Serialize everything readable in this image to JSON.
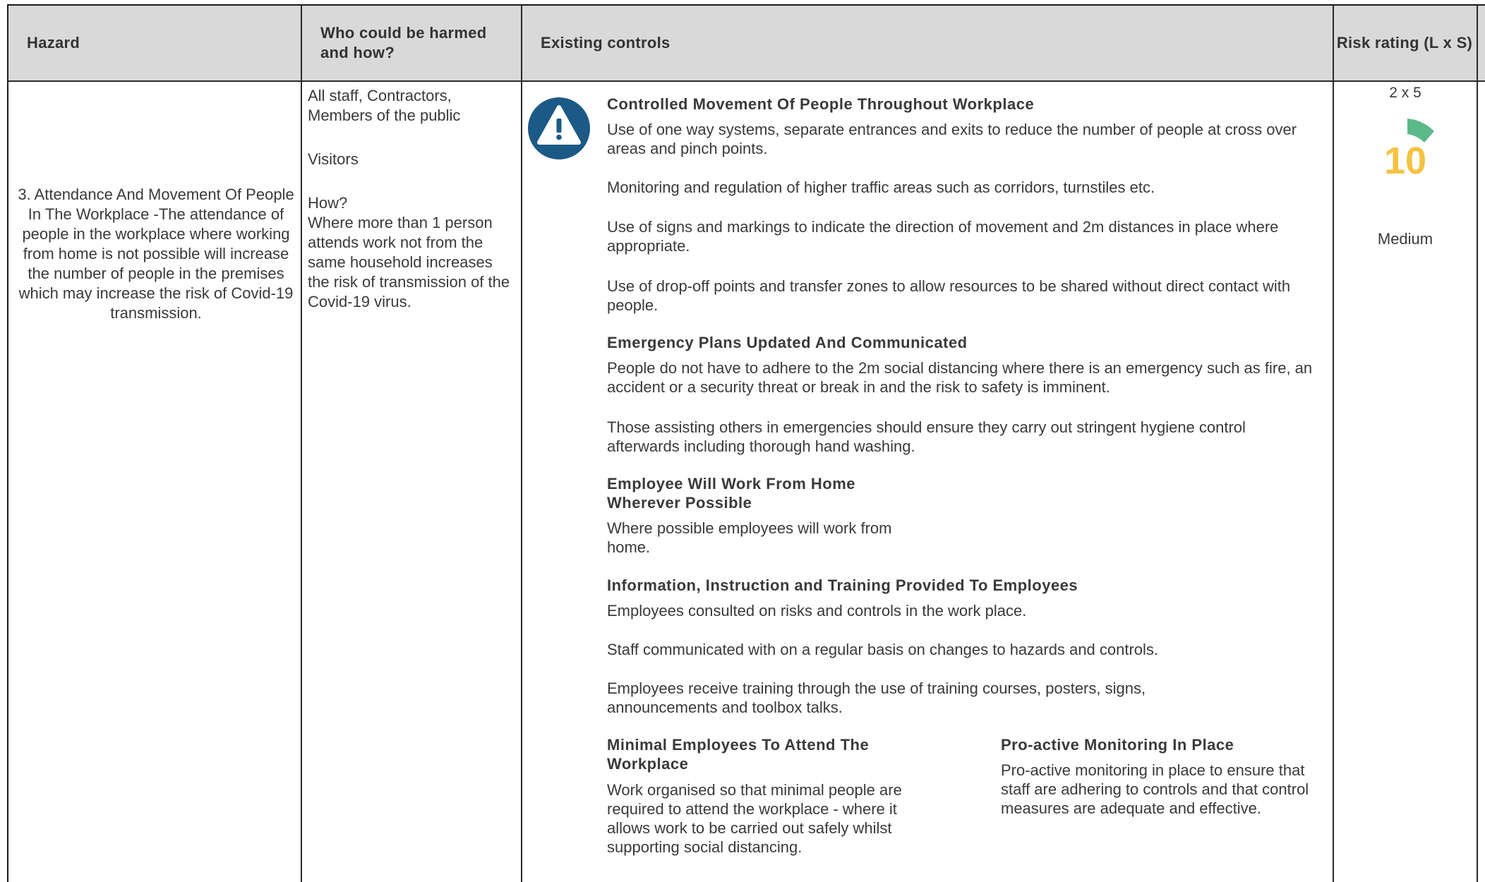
{
  "header": {
    "hazard": "Hazard",
    "who": "Who could be harmed and how?",
    "controls": "Existing controls",
    "risk": "Risk rating (L x S)"
  },
  "hazard": {
    "text": "3. Attendance And Movement Of People In The Workplace -The attendance of people in the workplace where working from home is not possible will increase the number of people in the premises which may increase the risk of Covid-19 transmission."
  },
  "who": {
    "groups": "All staff, Contractors, Members of the public",
    "visitors": "Visitors",
    "how_label": "How?",
    "how_text": "Where more than 1 person attends work not from the same household increases the risk of transmission of the Covid-19 virus."
  },
  "controls": {
    "icon": "warning-icon",
    "icon_color": "#1b5a86",
    "movement": {
      "heading": "Controlled Movement Of People Throughout Workplace",
      "p1": "Use of one way systems, separate entrances and exits to reduce the number of people at cross over areas and pinch points.",
      "p2": "Monitoring and regulation of higher traffic areas such as corridors, turnstiles etc.",
      "p3": "Use of signs and markings to indicate the direction of movement and 2m distances in place where appropriate.",
      "p4": "Use of drop-off points and transfer zones to allow resources to be shared without direct contact with people."
    },
    "emergency": {
      "heading": "Emergency Plans Updated And Communicated",
      "p1": "People do not have to adhere to the 2m social distancing where there is an emergency such as fire, an accident or a security threat or break in and the risk to safety is imminent.",
      "p2": "Those assisting others in emergencies should ensure they carry out stringent hygiene control afterwards including thorough hand washing."
    },
    "wfh": {
      "heading": "Employee Will Work From Home Wherever Possible",
      "p1": "Where possible employees will work from home."
    },
    "training": {
      "heading": "Information, Instruction and Training Provided To Employees",
      "p1": "Employees consulted on risks and controls in the work place.",
      "p2": "Staff communicated with on a regular basis on changes to hazards and controls.",
      "p3": "Employees receive training through the use of training courses, posters, signs, announcements and toolbox talks."
    },
    "minimal": {
      "heading": "Minimal Employees To Attend The Workplace",
      "p1": "Work organised so that minimal people are required to attend the workplace - where it allows work to be carried out safely whilst supporting social distancing."
    },
    "proactive": {
      "heading": "Pro-active Monitoring In Place",
      "p1": "Pro-active monitoring in place to ensure that staff are adhering to controls and that control measures are adequate and effective."
    }
  },
  "risk": {
    "likelihood_x_severity": "2 x 5",
    "score": "10",
    "level": "Medium",
    "score_color": "#f5c242",
    "gauge_color": "#5cb98a",
    "gauge_icon": "risk-gauge-icon"
  }
}
